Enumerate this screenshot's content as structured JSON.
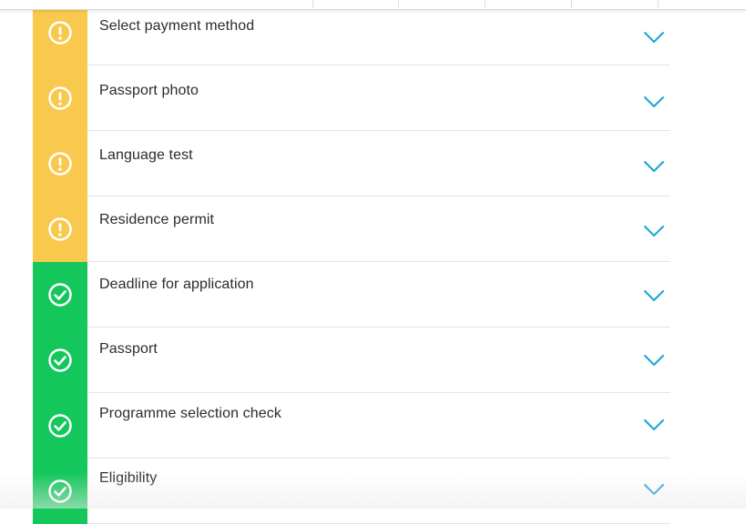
{
  "colors": {
    "warning": "#f8c94c",
    "success": "#13c75a",
    "chevron": "#1aa3d9",
    "text": "#2b2b2b"
  },
  "checklist": {
    "items": [
      {
        "label": "Select payment method",
        "status": "warning",
        "icon": "exclamation-circle-icon"
      },
      {
        "label": "Passport photo",
        "status": "warning",
        "icon": "exclamation-circle-icon"
      },
      {
        "label": "Language test",
        "status": "warning",
        "icon": "exclamation-circle-icon"
      },
      {
        "label": "Residence permit",
        "status": "warning",
        "icon": "exclamation-circle-icon"
      },
      {
        "label": "Deadline for application",
        "status": "success",
        "icon": "check-circle-icon"
      },
      {
        "label": "Passport",
        "status": "success",
        "icon": "check-circle-icon"
      },
      {
        "label": "Programme selection check",
        "status": "success",
        "icon": "check-circle-icon"
      },
      {
        "label": "Eligibility",
        "status": "success",
        "icon": "check-circle-icon"
      }
    ],
    "expand_icon": "chevron-down-icon"
  }
}
